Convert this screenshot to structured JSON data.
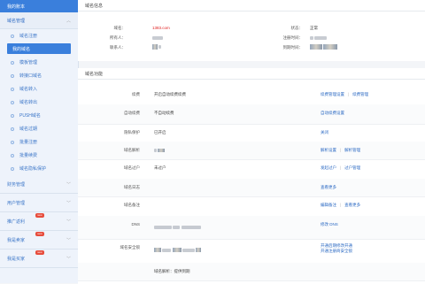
{
  "sidebar": {
    "header": "我的账本",
    "section": "域名管理",
    "subitems": [
      {
        "label": "域名注册",
        "active": false
      },
      {
        "label": "我的域名",
        "active": true
      },
      {
        "label": "模板管理",
        "active": false
      },
      {
        "label": "转接口域名",
        "active": false
      },
      {
        "label": "域名转入",
        "active": false
      },
      {
        "label": "域名转出",
        "active": false
      },
      {
        "label": "PUSH域名",
        "active": false
      },
      {
        "label": "域名过期",
        "active": false
      },
      {
        "label": "批量注册",
        "active": false
      },
      {
        "label": "批量续费",
        "active": false
      },
      {
        "label": "域名隐私保护",
        "active": false
      }
    ],
    "groups": [
      {
        "label": "财务管理",
        "badge": ""
      },
      {
        "label": "用户管理",
        "badge": ""
      },
      {
        "label": "推广返利",
        "badge": "new"
      },
      {
        "label": "我是卖家",
        "badge": "new"
      },
      {
        "label": "我是买家",
        "badge": "new"
      }
    ]
  },
  "info": {
    "title": "域名信息",
    "domain_label": "域名：",
    "domain_value": "1383.com",
    "status_label": "状态：",
    "status_value": "正常",
    "owner_label": "所有人：",
    "register_label": "注册时间：",
    "registrar_label": "联系人：",
    "expire_label": "到期时间："
  },
  "func": {
    "title": "域名功能",
    "rows": [
      {
        "name": "续费",
        "value": "开启自动续费续费",
        "actions": [
          "续费管理设置",
          "续费管理"
        ]
      },
      {
        "name": "自动续费",
        "value": "不自动续费",
        "actions": [
          "自动续费设置"
        ]
      },
      {
        "name": "隐私保护",
        "value": "已开启",
        "actions": [
          "关闭"
        ]
      },
      {
        "name": "域名解析",
        "value": "",
        "actions": [
          "解析设置",
          "解析管理"
        ]
      },
      {
        "name": "域名过户",
        "value": "未过户",
        "actions": [
          "发起过户",
          "过户管理"
        ]
      },
      {
        "name": "域名日志",
        "value": "",
        "actions": [
          "查看更多"
        ]
      },
      {
        "name": "域名备注",
        "value": "",
        "actions": [
          "编辑备注",
          "查看更多"
        ]
      },
      {
        "name": "DNS",
        "value": "",
        "actions": [
          "修改 DNS"
        ]
      },
      {
        "name": "域名安全锁",
        "value": "",
        "actions": [
          "开通后期修改开通",
          "开通注册商安全锁"
        ]
      },
      {
        "name": "",
        "value": "域名解析：提供到期",
        "actions": []
      }
    ]
  },
  "colors": {
    "accent": "#3a7fdc",
    "link": "#2c6ac3",
    "danger": "#e02020"
  }
}
